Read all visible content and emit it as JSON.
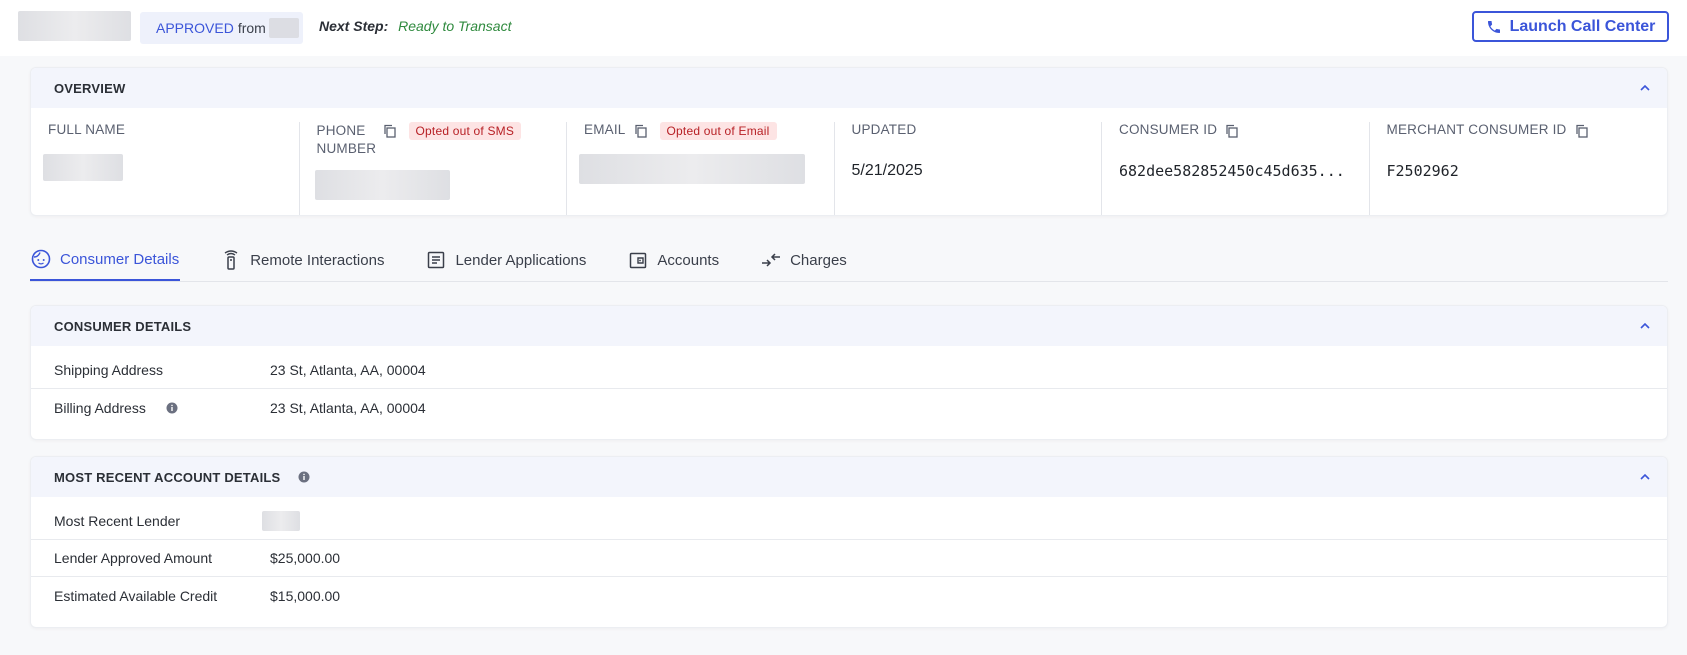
{
  "topbar": {
    "status": "APPROVED",
    "from_label": "from",
    "next_step_label": "Next Step:",
    "next_step_value": "Ready to Transact",
    "call_button_label": "Launch Call Center"
  },
  "overview": {
    "title": "OVERVIEW",
    "full_name_label": "FULL NAME",
    "phone_label": "PHONE NUMBER",
    "phone_badge": "Opted out of SMS",
    "email_label": "EMAIL",
    "email_badge": "Opted out of Email",
    "updated_label": "UPDATED",
    "updated_value": "5/21/2025",
    "consumer_id_label": "CONSUMER ID",
    "consumer_id_value": "682dee582852450c45d635...",
    "merchant_id_label": "MERCHANT CONSUMER ID",
    "merchant_id_value": "F2502962"
  },
  "tabs": [
    {
      "label": "Consumer Details",
      "icon": "face-icon",
      "active": true
    },
    {
      "label": "Remote Interactions",
      "icon": "remote-icon",
      "active": false
    },
    {
      "label": "Lender Applications",
      "icon": "document-icon",
      "active": false
    },
    {
      "label": "Accounts",
      "icon": "wallet-icon",
      "active": false
    },
    {
      "label": "Charges",
      "icon": "exchange-icon",
      "active": false
    }
  ],
  "consumer_details": {
    "title": "CONSUMER DETAILS",
    "rows": [
      {
        "label": "Shipping Address",
        "value": "23 St, Atlanta, AA, 00004"
      },
      {
        "label": "Billing Address",
        "value": "23 St, Atlanta, AA, 00004"
      }
    ]
  },
  "recent_account": {
    "title": "MOST RECENT ACCOUNT DETAILS",
    "rows": [
      {
        "label": "Most Recent Lender",
        "value": ""
      },
      {
        "label": "Lender Approved Amount",
        "value": "$25,000.00"
      },
      {
        "label": "Estimated Available Credit",
        "value": "$15,000.00"
      }
    ]
  },
  "colors": {
    "accent": "#3b55d9",
    "success": "#2f8a3e",
    "danger_bg": "#fde4e4",
    "danger_text": "#b72025"
  }
}
